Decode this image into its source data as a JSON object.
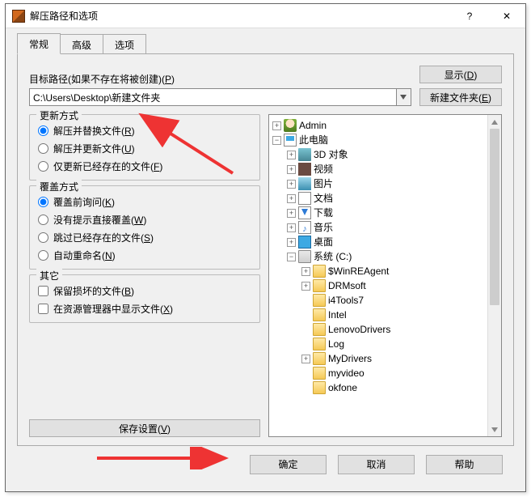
{
  "window": {
    "title": "解压路径和选项",
    "help": "?",
    "close": "✕"
  },
  "tabs": {
    "general": "常规",
    "advanced": "高级",
    "options": "选项"
  },
  "dest": {
    "label_pre": "目标路径(如果不存在将被创建)(",
    "label_key": "P",
    "label_post": ")",
    "value": "C:\\Users\\Desktop\\新建文件夹"
  },
  "side": {
    "show_pre": "显示(",
    "show_key": "D",
    "show_post": ")",
    "new_pre": "新建文件夹(",
    "new_key": "E",
    "new_post": ")"
  },
  "update": {
    "title": "更新方式",
    "r1_pre": "解压并替换文件(",
    "r1_key": "R",
    "r1_post": ")",
    "r2_pre": "解压并更新文件(",
    "r2_key": "U",
    "r2_post": ")",
    "r3_pre": "仅更新已经存在的文件(",
    "r3_key": "F",
    "r3_post": ")"
  },
  "overwrite": {
    "title": "覆盖方式",
    "r1_pre": "覆盖前询问(",
    "r1_key": "K",
    "r1_post": ")",
    "r2_pre": "没有提示直接覆盖(",
    "r2_key": "W",
    "r2_post": ")",
    "r3_pre": "跳过已经存在的文件(",
    "r3_key": "S",
    "r3_post": ")",
    "r4_pre": "自动重命名(",
    "r4_key": "N",
    "r4_post": ")"
  },
  "misc": {
    "title": "其它",
    "c1_pre": "保留损坏的文件(",
    "c1_key": "B",
    "c1_post": ")",
    "c2_pre": "在资源管理器中显示文件(",
    "c2_key": "X",
    "c2_post": ")"
  },
  "save": {
    "pre": "保存设置(",
    "key": "V",
    "post": ")"
  },
  "tree": {
    "admin": "Admin",
    "this_pc": "此电脑",
    "n3d": "3D 对象",
    "video": "视频",
    "pictures": "图片",
    "documents": "文档",
    "download": "下载",
    "music": "音乐",
    "desktop": "桌面",
    "system_c": "系统 (C:)",
    "f_winre": "$WinREAgent",
    "f_drm": "DRMsoft",
    "f_i4": "i4Tools7",
    "f_intel": "Intel",
    "f_lenovo": "LenovoDrivers",
    "f_log": "Log",
    "f_mydrivers": "MyDrivers",
    "f_myvideo": "myvideo",
    "f_okfone": "okfone"
  },
  "footer": {
    "ok": "确定",
    "cancel": "取消",
    "help": "帮助"
  }
}
